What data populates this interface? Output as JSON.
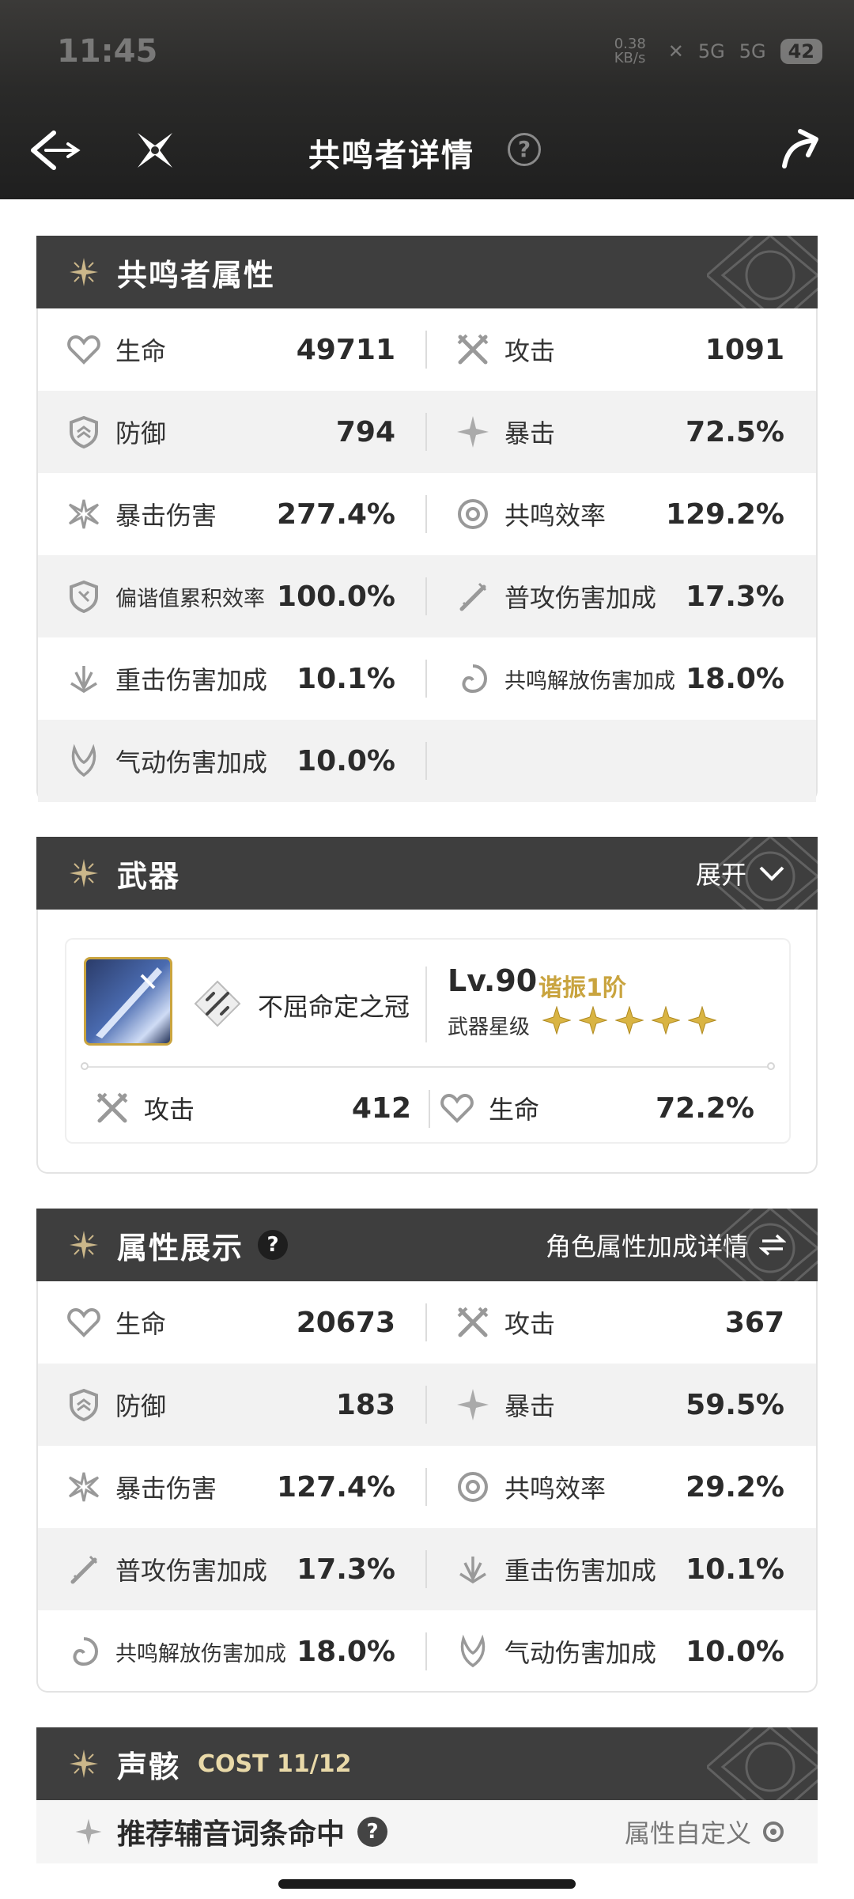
{
  "status_bar": {
    "time": "11:45",
    "speed": "0.38 KB/s",
    "net1": "5G",
    "net2": "5G",
    "battery": "42"
  },
  "header": {
    "title": "共鸣者详情",
    "help": "?"
  },
  "resonator_attributes": {
    "title": "共鸣者属性",
    "rows": [
      [
        {
          "icon": "heart-icon",
          "label": "生命",
          "value": "49711"
        },
        {
          "icon": "crossed-swords-icon",
          "label": "攻击",
          "value": "1091"
        }
      ],
      [
        {
          "icon": "shield-icon",
          "label": "防御",
          "value": "794"
        },
        {
          "icon": "crit-star-icon",
          "label": "暴击",
          "value": "72.5%"
        }
      ],
      [
        {
          "icon": "burst-icon",
          "label": "暴击伤害",
          "value": "277.4%"
        },
        {
          "icon": "resonance-ring-icon",
          "label": "共鸣效率",
          "value": "129.2%"
        }
      ],
      [
        {
          "icon": "tuning-shield-icon",
          "label": "偏谐值累积效率",
          "value": "100.0%"
        },
        {
          "icon": "slash-icon",
          "label": "普攻伤害加成",
          "value": "17.3%"
        }
      ],
      [
        {
          "icon": "heavy-attack-icon",
          "label": "重击伤害加成",
          "value": "10.1%"
        },
        {
          "icon": "liberation-icon",
          "label": "共鸣解放伤害加成",
          "value": "18.0%"
        }
      ],
      [
        {
          "icon": "echo-wing-icon",
          "label": "气动伤害加成",
          "value": "10.0%"
        },
        null
      ]
    ]
  },
  "weapon": {
    "title": "武器",
    "expand_label": "展开",
    "name": "不屈命定之冠",
    "level": "Lv.90",
    "sync": "谐振1阶",
    "star_label": "武器星级",
    "stars": 5,
    "stats": [
      {
        "icon": "crossed-swords-icon",
        "label": "攻击",
        "value": "412"
      },
      {
        "icon": "heart-icon",
        "label": "生命",
        "value": "72.2%"
      }
    ]
  },
  "attribute_display": {
    "title": "属性展示",
    "help": "?",
    "detail_link": "角色属性加成详情",
    "rows": [
      [
        {
          "icon": "heart-icon",
          "label": "生命",
          "value": "20673"
        },
        {
          "icon": "crossed-swords-icon",
          "label": "攻击",
          "value": "367"
        }
      ],
      [
        {
          "icon": "shield-icon",
          "label": "防御",
          "value": "183"
        },
        {
          "icon": "crit-star-icon",
          "label": "暴击",
          "value": "59.5%"
        }
      ],
      [
        {
          "icon": "burst-icon",
          "label": "暴击伤害",
          "value": "127.4%"
        },
        {
          "icon": "resonance-ring-icon",
          "label": "共鸣效率",
          "value": "29.2%"
        }
      ],
      [
        {
          "icon": "slash-icon",
          "label": "普攻伤害加成",
          "value": "17.3%"
        },
        {
          "icon": "heavy-attack-icon",
          "label": "重击伤害加成",
          "value": "10.1%"
        }
      ],
      [
        {
          "icon": "liberation-icon",
          "label": "共鸣解放伤害加成",
          "value": "18.0%"
        },
        {
          "icon": "echo-wing-icon",
          "label": "气动伤害加成",
          "value": "10.0%"
        }
      ]
    ]
  },
  "echo": {
    "title": "声骸",
    "cost": "COST 11/12",
    "sub_title": "推荐辅音词条命中",
    "sub_help": "?",
    "custom_label": "属性自定义"
  }
}
